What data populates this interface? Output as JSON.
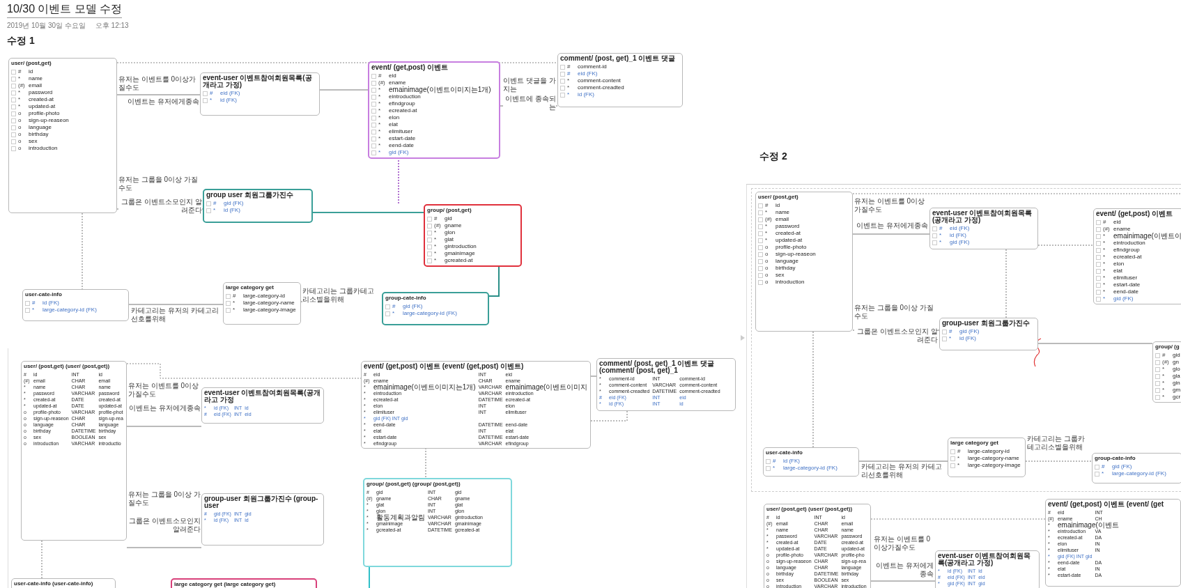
{
  "page": {
    "title": "10/30 이벤트 모델 수정",
    "date": "2019년 10월 30일 수요일",
    "time": "오후 12:13"
  },
  "sections": [
    {
      "heading": "수정 1"
    },
    {
      "heading": "수정 2"
    }
  ],
  "diagrams": [
    {
      "entities": [
        {
          "kind": "logical",
          "title": "user/ (post,get)",
          "color": "#b8b8b8",
          "rows": [
            {
              "mark": "#",
              "name": "id",
              "foreign": false
            },
            {
              "mark": "*",
              "name": "name",
              "foreign": false
            },
            {
              "mark": "(#)",
              "name": "email",
              "foreign": false
            },
            {
              "mark": "*",
              "name": "password",
              "foreign": false
            },
            {
              "mark": "*",
              "name": "created-at",
              "foreign": false
            },
            {
              "mark": "*",
              "name": "updated-at",
              "foreign": false
            },
            {
              "mark": "o",
              "name": "profile-photo",
              "foreign": false
            },
            {
              "mark": "o",
              "name": "sign-up-reaseon",
              "foreign": false
            },
            {
              "mark": "o",
              "name": "language",
              "foreign": false
            },
            {
              "mark": "o",
              "name": "birthday",
              "foreign": false
            },
            {
              "mark": "o",
              "name": "sex",
              "foreign": false
            },
            {
              "mark": "o",
              "name": "introduction",
              "foreign": false
            }
          ]
        },
        {
          "kind": "logical",
          "title": "event-user 이벤트참여회원목록(공개라고 가정)",
          "color": "#b8b8b8",
          "rows": [
            {
              "mark": "#",
              "name": "eid (FK)",
              "foreign": true
            },
            {
              "mark": "*",
              "name": "id (FK)",
              "foreign": true
            }
          ]
        },
        {
          "kind": "logical",
          "title": "event/ (get,post) 이벤트",
          "color": "#c77ee0",
          "rows": [
            {
              "mark": "#",
              "name": "eid",
              "foreign": false
            },
            {
              "mark": "(#)",
              "name": "ename",
              "foreign": false
            },
            {
              "mark": "*",
              "name": "emainimage(이벤트이미지는1개)",
              "foreign": false
            },
            {
              "mark": "*",
              "name": "eintroduction",
              "foreign": false
            },
            {
              "mark": "*",
              "name": "efindgroup",
              "foreign": false
            },
            {
              "mark": "*",
              "name": "ecreated-at",
              "foreign": false
            },
            {
              "mark": "*",
              "name": "elon",
              "foreign": false
            },
            {
              "mark": "*",
              "name": "elat",
              "foreign": false
            },
            {
              "mark": "*",
              "name": "elimituser",
              "foreign": false
            },
            {
              "mark": "*",
              "name": "estart-date",
              "foreign": false
            },
            {
              "mark": "*",
              "name": "eend-date",
              "foreign": false
            },
            {
              "mark": "*",
              "name": "gid (FK)",
              "foreign": true
            }
          ]
        },
        {
          "kind": "logical",
          "title": "comment/ (post, get)_1 이벤트 댓글",
          "color": "#b8b8b8",
          "rows": [
            {
              "mark": "#",
              "name": "comment-id",
              "foreign": false
            },
            {
              "mark": "#",
              "name": "eid (FK)",
              "foreign": true
            },
            {
              "mark": "*",
              "name": "comment-content",
              "foreign": false
            },
            {
              "mark": "*",
              "name": "comment-creadted",
              "foreign": false
            },
            {
              "mark": "*",
              "name": "id (FK)",
              "foreign": true
            }
          ]
        },
        {
          "kind": "logical",
          "title": "group user 회원그룹가진수",
          "color": "#3a9f98",
          "rows": [
            {
              "mark": "#",
              "name": "gid (FK)",
              "foreign": true
            },
            {
              "mark": "*",
              "name": "id (FK)",
              "foreign": true
            }
          ]
        },
        {
          "kind": "logical",
          "title": "group/ (post,get)",
          "color": "#e0303c",
          "rows": [
            {
              "mark": "#",
              "name": "gid",
              "foreign": false
            },
            {
              "mark": "(#)",
              "name": "gname",
              "foreign": false
            },
            {
              "mark": "*",
              "name": "glon",
              "foreign": false
            },
            {
              "mark": "*",
              "name": "glat",
              "foreign": false
            },
            {
              "mark": "*",
              "name": "gintroduction",
              "foreign": false
            },
            {
              "mark": "*",
              "name": "gmainimage",
              "foreign": false
            },
            {
              "mark": "*",
              "name": "gcreated-at",
              "foreign": false
            }
          ]
        },
        {
          "kind": "logical",
          "title": "user-cate-info",
          "color": "#b8b8b8",
          "rows": [
            {
              "mark": "#",
              "name": "id (FK)",
              "foreign": true
            },
            {
              "mark": "*",
              "name": "large-category-id (FK)",
              "foreign": true
            }
          ]
        },
        {
          "kind": "logical",
          "title": "large category get",
          "color": "#b8b8b8",
          "rows": [
            {
              "mark": "#",
              "name": "large-category-id",
              "foreign": false
            },
            {
              "mark": "*",
              "name": "large-category-name",
              "foreign": false
            },
            {
              "mark": "*",
              "name": "large-category-image",
              "foreign": false
            }
          ]
        },
        {
          "kind": "logical",
          "title": "group-cate-info",
          "color": "#3a9f98",
          "rows": [
            {
              "mark": "#",
              "name": "gid (FK)",
              "foreign": true
            },
            {
              "mark": "*",
              "name": "large-category-id (FK)",
              "foreign": true
            }
          ]
        }
      ],
      "labels": [
        "유저는 이벤트를 0이상가질수도",
        "이벤트는 유저에게종속",
        "유저는 그룹을 0이상 가질수도",
        "그룹은 이벤트소모인지 알려준다",
        "카테고리는 유저의 카테고리선호를위해",
        "카테고리는 그룹카테고리소별을위해",
        "이벤트 댓글을 가지는",
        "이벤트에 종속되는"
      ]
    },
    {
      "entities": [
        {
          "kind": "relational",
          "title": "user/ (post,get) (user/ (post,get))",
          "color": "#b8b8b8",
          "rows": [
            {
              "mark": "#",
              "name": "id",
              "type": "INT",
              "column": "id",
              "foreign": false
            },
            {
              "mark": "(#)",
              "name": "email",
              "type": "CHAR",
              "column": "email",
              "foreign": false
            },
            {
              "mark": "*",
              "name": "name",
              "type": "CHAR",
              "column": "name",
              "foreign": false
            },
            {
              "mark": "*",
              "name": "password",
              "type": "VARCHAR",
              "column": "password",
              "foreign": false
            },
            {
              "mark": "*",
              "name": "created-at",
              "type": "DATE",
              "column": "created-at",
              "foreign": false
            },
            {
              "mark": "*",
              "name": "updated-at",
              "type": "DATE",
              "column": "updated-at",
              "foreign": false
            },
            {
              "mark": "o",
              "name": "profile-photo",
              "type": "VARCHAR",
              "column": "profile-phot",
              "foreign": false
            },
            {
              "mark": "o",
              "name": "sign-up-reaseon",
              "type": "CHAR",
              "column": "sign-up-rea",
              "foreign": false
            },
            {
              "mark": "o",
              "name": "language",
              "type": "CHAR",
              "column": "language",
              "foreign": false
            },
            {
              "mark": "o",
              "name": "birthday",
              "type": "DATETIME",
              "column": "birthday",
              "foreign": false
            },
            {
              "mark": "o",
              "name": "sex",
              "type": "BOOLEAN",
              "column": "sex",
              "foreign": false
            },
            {
              "mark": "o",
              "name": "introduction",
              "type": "VARCHAR",
              "column": "introductio",
              "foreign": false
            }
          ]
        },
        {
          "kind": "relational",
          "title": "event-user 이벤트참여회원목록(공개라고 가정",
          "color": "#b8b8b8",
          "rows": [
            {
              "mark": "*",
              "name": "id (FK)",
              "type": "INT",
              "column": "id",
              "foreign": true
            },
            {
              "mark": "#",
              "name": "eid (FK)",
              "type": "INT",
              "column": "eid",
              "foreign": true
            }
          ]
        },
        {
          "kind": "relational",
          "title": "event/ (get,post) 이벤트 (event/ (get,post) 이벤트)",
          "color": "#b8b8b8",
          "rows": [
            {
              "mark": "#",
              "name": "eid",
              "type": "INT",
              "column": "eid",
              "foreign": false
            },
            {
              "mark": "(#)",
              "name": "ename",
              "type": "CHAR",
              "column": "ename",
              "foreign": false
            },
            {
              "mark": "*",
              "name": "emainimage(이벤트이미지는1개)",
              "type": "VARCHAR",
              "column": "emainimage(이벤트이미지",
              "foreign": false
            },
            {
              "mark": "*",
              "name": "eintroduction",
              "type": "VARCHAR",
              "column": "eintroduction",
              "foreign": false
            },
            {
              "mark": "*",
              "name": "ecreated-at",
              "type": "DATETIME",
              "column": "ecreated-at",
              "foreign": false
            },
            {
              "mark": "*",
              "name": "elon",
              "type": "INT",
              "column": "elon",
              "foreign": false
            },
            {
              "mark": "*",
              "name": "elimituser",
              "type": "INT",
              "column": "elimituser",
              "foreign": false
            },
            {
              "mark": "*",
              "name": "gid (FK) INT  gid",
              "foreign": true
            },
            {
              "mark": "*",
              "name": "eend-date",
              "type": "DATETIME",
              "column": "eend-date",
              "foreign": false
            },
            {
              "mark": "*",
              "name": "elat",
              "type": "INT",
              "column": "elat",
              "foreign": false
            },
            {
              "mark": "*",
              "name": "estart-date",
              "type": "DATETIME",
              "column": "estart-date",
              "foreign": false
            },
            {
              "mark": "*",
              "name": "efindgroup",
              "type": "VARCHAR",
              "column": "efindgroup",
              "foreign": false
            }
          ]
        },
        {
          "kind": "relational",
          "title": "comment/ (post, get)_1 이벤트 댓글 (comment/ (post, get)_1",
          "color": "#b8b8b8",
          "rows": [
            {
              "mark": "*",
              "name": "comment-id",
              "type": "INT",
              "column": "comment-id",
              "foreign": false
            },
            {
              "mark": "*",
              "name": "comment-content",
              "type": "VARCHAR",
              "column": "comment-content",
              "foreign": false
            },
            {
              "mark": "*",
              "name": "comment-creadted",
              "type": "DATETIME",
              "column": "comment-creadted",
              "foreign": false
            },
            {
              "mark": "#",
              "name": "eid (FK)",
              "type": "INT",
              "column": "eid",
              "foreign": true
            },
            {
              "mark": "*",
              "name": "id (FK)",
              "type": "INT",
              "column": "id",
              "foreign": true
            }
          ]
        },
        {
          "kind": "relational",
          "title": "group-user 회원그룹가진수 (group-user",
          "color": "#b8b8b8",
          "rows": [
            {
              "mark": "#",
              "name": "gid (FK)",
              "type": "INT",
              "column": "gid",
              "foreign": true
            },
            {
              "mark": "*",
              "name": "id (FK)",
              "type": "INT",
              "column": "id",
              "foreign": true
            }
          ]
        },
        {
          "kind": "relational",
          "title": "group/ (post,get) (group/ (post,get))",
          "color": "#7fd8dc",
          "rows": [
            {
              "mark": "#",
              "name": "gid",
              "type": "INT",
              "column": "gid",
              "foreign": false
            },
            {
              "mark": "(#)",
              "name": "gname",
              "type": "CHAR",
              "column": "gname",
              "foreign": false
            },
            {
              "mark": "*",
              "name": "glat",
              "type": "INT",
              "column": "glat",
              "foreign": false
            },
            {
              "mark": "*",
              "name": "glon",
              "type": "INT",
              "column": "glon",
              "foreign": false
            },
            {
              "mark": "*",
              "name": "활동계획과알림",
              "type": "VARCHAR",
              "column": "gintroduction",
              "foreign": false
            },
            {
              "mark": "*",
              "name": "gmainimage",
              "type": "VARCHAR",
              "column": "gmainimage",
              "foreign": false
            },
            {
              "mark": "*",
              "name": "gcreated-at",
              "type": "DATETIME",
              "column": "gcreated-at",
              "foreign": false
            }
          ]
        },
        {
          "kind": "relational",
          "title": "user-cate-info (user-cate-info)",
          "color": "#b8b8b8"
        },
        {
          "kind": "relational",
          "title": "large category get (large category get)",
          "color": "#d8407a"
        }
      ],
      "labels": [
        "유저는 이벤트를 0이상가질수도",
        "이벤트는 유저에게종속",
        "유저는 그룹을 0이상 가질수도",
        "그룹은 이벤트소모인지 알려준다"
      ]
    },
    {
      "entities": [
        {
          "kind": "logical",
          "title": "user/ (post,get)",
          "color": "#b8b8b8",
          "rows": [
            {
              "mark": "#",
              "name": "id",
              "foreign": false
            },
            {
              "mark": "*",
              "name": "name",
              "foreign": false
            },
            {
              "mark": "(#)",
              "name": "email",
              "foreign": false
            },
            {
              "mark": "*",
              "name": "password",
              "foreign": false
            },
            {
              "mark": "*",
              "name": "created-at",
              "foreign": false
            },
            {
              "mark": "*",
              "name": "updated-at",
              "foreign": false
            },
            {
              "mark": "o",
              "name": "profile-photo",
              "foreign": false
            },
            {
              "mark": "o",
              "name": "sign-up-reaseon",
              "foreign": false
            },
            {
              "mark": "o",
              "name": "language",
              "foreign": false
            },
            {
              "mark": "o",
              "name": "birthday",
              "foreign": false
            },
            {
              "mark": "o",
              "name": "sex",
              "foreign": false
            },
            {
              "mark": "o",
              "name": "introduction",
              "foreign": false
            }
          ]
        },
        {
          "kind": "logical",
          "title": "event-user 이벤트참여회원목록(공개라고 가정)",
          "color": "#b8b8b8",
          "rows": [
            {
              "mark": "#",
              "name": "eid (FK)",
              "foreign": true
            },
            {
              "mark": "*",
              "name": "id (FK)",
              "foreign": true
            },
            {
              "mark": "*",
              "name": "gid (FK)",
              "foreign": true
            }
          ]
        },
        {
          "kind": "logical",
          "title": "event/ (get,post) 이벤트",
          "color": "#b8b8b8",
          "rows": [
            {
              "mark": "#",
              "name": "eid",
              "foreign": false
            },
            {
              "mark": "(#)",
              "name": "ename",
              "foreign": false
            },
            {
              "mark": "*",
              "name": "emainimage(이벤트이",
              "foreign": false
            },
            {
              "mark": "*",
              "name": "eintroduction",
              "foreign": false
            },
            {
              "mark": "*",
              "name": "efindgroup",
              "foreign": false
            },
            {
              "mark": "*",
              "name": "ecreated-at",
              "foreign": false
            },
            {
              "mark": "*",
              "name": "elon",
              "foreign": false
            },
            {
              "mark": "*",
              "name": "elat",
              "foreign": false
            },
            {
              "mark": "*",
              "name": "elimituser",
              "foreign": false
            },
            {
              "mark": "*",
              "name": "estart-date",
              "foreign": false
            },
            {
              "mark": "*",
              "name": "eend-date",
              "foreign": false
            },
            {
              "mark": "*",
              "name": "gid (FK)",
              "foreign": true
            }
          ]
        },
        {
          "kind": "logical",
          "title": "group-user 회원그룹가진수",
          "color": "#b8b8b8",
          "rows": [
            {
              "mark": "#",
              "name": "gid (FK)",
              "foreign": true
            },
            {
              "mark": "*",
              "name": "id (FK)",
              "foreign": true
            }
          ]
        },
        {
          "kind": "logical",
          "title": "group/ (g",
          "color": "#b8b8b8",
          "rows": [
            {
              "mark": "#",
              "name": "gid",
              "foreign": false
            },
            {
              "mark": "(#)",
              "name": "gn",
              "foreign": false
            },
            {
              "mark": "*",
              "name": "glo",
              "foreign": false
            },
            {
              "mark": "*",
              "name": "gla",
              "foreign": false
            },
            {
              "mark": "*",
              "name": "gin",
              "foreign": false
            },
            {
              "mark": "*",
              "name": "gm",
              "foreign": false
            },
            {
              "mark": "*",
              "name": "gcr",
              "foreign": false
            }
          ]
        },
        {
          "kind": "logical",
          "title": "user-cate-info",
          "color": "#b8b8b8",
          "rows": [
            {
              "mark": "#",
              "name": "id (FK)",
              "foreign": true
            },
            {
              "mark": "*",
              "name": "large-category-id (FK)",
              "foreign": true
            }
          ]
        },
        {
          "kind": "logical",
          "title": "large category get",
          "color": "#b8b8b8",
          "rows": [
            {
              "mark": "#",
              "name": "large-category-id",
              "foreign": false
            },
            {
              "mark": "*",
              "name": "large-category-name",
              "foreign": false
            },
            {
              "mark": "*",
              "name": "large-category-image",
              "foreign": false
            }
          ]
        },
        {
          "kind": "logical",
          "title": "group-cate-info",
          "color": "#b8b8b8",
          "rows": [
            {
              "mark": "#",
              "name": "gid (FK)",
              "foreign": true
            },
            {
              "mark": "*",
              "name": "large-category-id (FK)",
              "foreign": true
            }
          ]
        },
        {
          "kind": "relational",
          "title": "user/ (post,get) (user/ (post,get))",
          "color": "#b8b8b8",
          "rows": [
            {
              "mark": "#",
              "name": "id",
              "type": "INT",
              "column": "id",
              "foreign": false
            },
            {
              "mark": "(#)",
              "name": "email",
              "type": "CHAR",
              "column": "email",
              "foreign": false
            },
            {
              "mark": "*",
              "name": "name",
              "type": "CHAR",
              "column": "name",
              "foreign": false
            },
            {
              "mark": "*",
              "name": "password",
              "type": "VARCHAR",
              "column": "password",
              "foreign": false
            },
            {
              "mark": "*",
              "name": "created-at",
              "type": "DATE",
              "column": "created-at",
              "foreign": false
            },
            {
              "mark": "*",
              "name": "updated-at",
              "type": "DATE",
              "column": "updated-at",
              "foreign": false
            },
            {
              "mark": "o",
              "name": "profile-photo",
              "type": "VARCHAR",
              "column": "profile-pho",
              "foreign": false
            },
            {
              "mark": "o",
              "name": "sign-up-reaseon",
              "type": "CHAR",
              "column": "sign-up-rea",
              "foreign": false
            },
            {
              "mark": "o",
              "name": "language",
              "type": "CHAR",
              "column": "language",
              "foreign": false
            },
            {
              "mark": "o",
              "name": "birthday",
              "type": "DATETIME",
              "column": "birthday",
              "foreign": false
            },
            {
              "mark": "o",
              "name": "sex",
              "type": "BOOLEAN",
              "column": "sex",
              "foreign": false
            },
            {
              "mark": "o",
              "name": "introduction",
              "type": "VARCHAR",
              "column": "introduction",
              "foreign": false
            }
          ]
        },
        {
          "kind": "relational",
          "title": "event-user 이벤트참여회원목록(공개라고 가정)",
          "color": "#b8b8b8",
          "rows": [
            {
              "mark": "*",
              "name": "id (FK)",
              "type": "INT",
              "column": "id",
              "foreign": true
            },
            {
              "mark": "#",
              "name": "eid (FK)",
              "type": "INT",
              "column": "eid",
              "foreign": true
            },
            {
              "mark": "*",
              "name": "gid (FK)",
              "type": "INT",
              "column": "gid",
              "foreign": true
            }
          ]
        },
        {
          "kind": "relational",
          "title": "event/ (get,post) 이벤트 (event/ (get",
          "color": "#b8b8b8",
          "rows": [
            {
              "mark": "#",
              "name": "eid",
              "type": "INT",
              "foreign": false
            },
            {
              "mark": "(#)",
              "name": "ename",
              "type": "CH",
              "foreign": false
            },
            {
              "mark": "*",
              "name": "emainimage(이벤트",
              "foreign": false
            },
            {
              "mark": "*",
              "name": "eintroduction",
              "type": "VA",
              "foreign": false
            },
            {
              "mark": "*",
              "name": "ecreated-at",
              "type": "DA",
              "foreign": false
            },
            {
              "mark": "*",
              "name": "elon",
              "type": "IN",
              "foreign": false
            },
            {
              "mark": "*",
              "name": "elimituser",
              "type": "IN",
              "foreign": false
            },
            {
              "mark": "*",
              "name": "gid (FK) INT  gid",
              "foreign": true
            },
            {
              "mark": "*",
              "name": "eend-date",
              "type": "DA",
              "foreign": false
            },
            {
              "mark": "*",
              "name": "elat",
              "type": "IN",
              "foreign": false
            },
            {
              "mark": "*",
              "name": "estart-date",
              "type": "DA",
              "foreign": false
            }
          ]
        }
      ],
      "labels": [
        "유저는 이벤트를 0이상가질수도",
        "이벤트는 유저에게종속",
        "유저는 그룹을 0이상 가질수도",
        "그룹은 이벤트소모인지 알려준다",
        "카테고리는 유저의 카테고리선호를위해",
        "카테고리는 그룹카테고리소별을위해",
        "유저는 이벤트를 0이상가질수도",
        "이벤트는 유저에게종속"
      ]
    }
  ]
}
